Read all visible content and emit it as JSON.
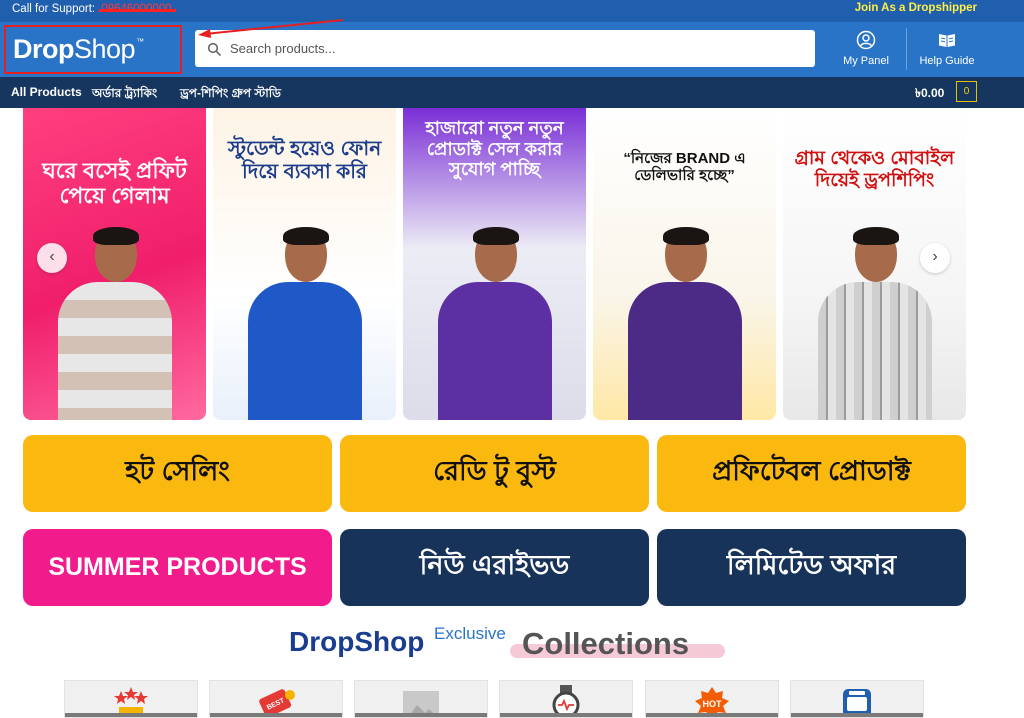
{
  "topbar": {
    "support_label": "Call for Support:",
    "support_number": "09646000000",
    "dropshipper_link": "Join As a Dropshipper"
  },
  "header": {
    "logo_bold": "Drop",
    "logo_regular": "Shop",
    "logo_tm": "™",
    "search_placeholder": "Search products...",
    "my_panel_label": "My Panel",
    "help_guide_label": "Help Guide"
  },
  "nav": {
    "items": [
      "All Products",
      "অর্ডার ট্র্যাকিং",
      "ড্রপ-শিপিং গ্রুপ স্টাডি"
    ],
    "cart_amount": "৳0.00",
    "cart_count": "0"
  },
  "slider": {
    "slides": [
      {
        "text": "ঘরে বসেই প্রফিট পেয়ে গেলাম"
      },
      {
        "text": "স্টুডেন্ট হয়েও ফোন দিয়ে ব্যবসা করি"
      },
      {
        "text": "হাজারো নতুন নতুন প্রোডাক্ট সেল করার সুযোগ পাচ্ছি"
      },
      {
        "text": "“নিজের BRAND এ ডেলিভারি হচ্ছে”"
      },
      {
        "text": "গ্রাম থেকেও মোবাইল দিয়েই ড্রপশিপিং"
      }
    ],
    "prev_icon": "‹",
    "next_icon": "›"
  },
  "tiles": {
    "hot_selling": "হট সেলিং",
    "ready_to_boost": "রেডি টু বুস্ট",
    "profitable_product": "প্রফিটেবল প্রোডাক্ট",
    "summer_products": "SUMMER PRODUCTS",
    "new_arrived": "নিউ এরাইভড",
    "limited_offer": "লিমিটেড অফার"
  },
  "collections": {
    "brand": "DropShop",
    "exclusive": "Exclusive",
    "title": "Collections"
  },
  "colors": {
    "topbar": "#1f5fae",
    "header": "#2a74c8",
    "nav": "#17365f",
    "tile_yellow": "#fbb910",
    "tile_pink": "#f11b8c",
    "tile_navy": "#17335a",
    "annotation_red": "#e62020"
  },
  "icons": {
    "search": "search-icon",
    "panel": "user-circle-icon",
    "guide": "book-icon"
  }
}
